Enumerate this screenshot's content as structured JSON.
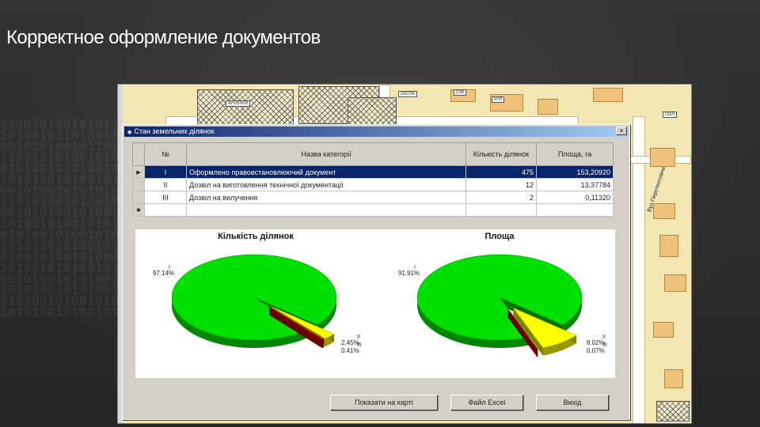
{
  "slide": {
    "title": "Корректное оформление документов"
  },
  "map": {
    "labels": [
      "АРХІВНИЙ",
      "ШКОЛА",
      "ОЗВ",
      "КОП",
      "ОШН",
      "ЖКВ",
      "СІЗО"
    ],
    "street": "Вул.Перспективна"
  },
  "dialog": {
    "title": "Стан земельних ділянок",
    "close_glyph": "×",
    "table": {
      "columns": [
        "№",
        "Назва категорії",
        "Кількість ділянок",
        "Площа, га"
      ],
      "rows": [
        {
          "indicator": "▶",
          "no": "I",
          "name": "Оформлено правовстановлюючий документ",
          "count": "475",
          "area": "153,20920",
          "selected": true
        },
        {
          "indicator": "",
          "no": "II",
          "name": "Дозвіл на виготовлення технічної документації",
          "count": "12",
          "area": "13,37784",
          "selected": false
        },
        {
          "indicator": "",
          "no": "III",
          "name": "Дозвіл на вилучення",
          "count": "2",
          "area": "0,11320",
          "selected": false
        },
        {
          "indicator": "✱",
          "no": "",
          "name": "",
          "count": "",
          "area": "",
          "selected": false
        }
      ]
    },
    "buttons": {
      "show_map": "Показати на карті",
      "excel": "Файл Excel",
      "exit": "Вихід"
    }
  },
  "chart_data": [
    {
      "type": "pie",
      "title": "Кількість ділянок",
      "categories": [
        "I",
        "II",
        "III"
      ],
      "values": [
        97.14,
        2.45,
        0.41
      ],
      "labels": [
        "97.14%",
        "2.45%",
        "0.41%"
      ],
      "colors": [
        "#00e000",
        "#ffff00",
        "#cc0000"
      ]
    },
    {
      "type": "pie",
      "title": "Площа",
      "categories": [
        "I",
        "II",
        "III"
      ],
      "values": [
        91.91,
        8.02,
        0.07
      ],
      "labels": [
        "91.91%",
        "8.02%",
        "0.07%"
      ],
      "colors": [
        "#00e000",
        "#ffff00",
        "#cc0000"
      ]
    }
  ]
}
